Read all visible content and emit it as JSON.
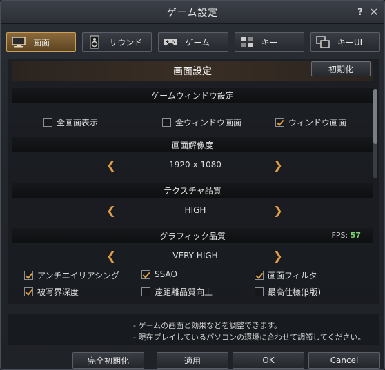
{
  "window": {
    "title": "ゲーム設定",
    "help_icon": "?",
    "close_icon": "✕"
  },
  "tabs": [
    {
      "label": "画面",
      "icon": "monitor-icon",
      "active": true
    },
    {
      "label": "サウンド",
      "icon": "speaker-icon",
      "active": false
    },
    {
      "label": "ゲーム",
      "icon": "gamepad-icon",
      "active": false
    },
    {
      "label": "キー",
      "icon": "keyboard-icon",
      "active": false
    },
    {
      "label": "キーUI",
      "icon": "windows-icon",
      "active": false
    }
  ],
  "screen": {
    "title": "画面設定",
    "reset_label": "初期化",
    "window_section": "ゲームウィンドウ設定",
    "window_options": [
      {
        "label": "全画面表示",
        "checked": false
      },
      {
        "label": "全ウィンドウ画面",
        "checked": false
      },
      {
        "label": "ウィンドウ画面",
        "checked": true
      }
    ],
    "resolution_section": "画面解像度",
    "resolution_value": "1920 x 1080",
    "texture_section": "テクスチャ品質",
    "texture_value": "HIGH",
    "graphics_section": "グラフィック品質",
    "fps_label": "FPS:",
    "fps_value": "57",
    "graphics_value": "VERY HIGH",
    "graphic_options": [
      {
        "label": "アンチエイリアシング",
        "checked": true
      },
      {
        "label": "SSAO",
        "checked": true
      },
      {
        "label": "画面フィルタ",
        "checked": true
      },
      {
        "label": "被写界深度",
        "checked": true
      },
      {
        "label": "遠距離品質向上",
        "checked": false
      },
      {
        "label": "最高仕様(β版)",
        "checked": false
      }
    ]
  },
  "info": {
    "line1": "- ゲームの画面と効果などを調整できます。",
    "line2": "- 現在プレイしているパソコンの環境に合わせて調節してください。"
  },
  "footer": {
    "full_reset": "完全初期化",
    "apply": "適用",
    "ok": "OK",
    "cancel": "Cancel"
  },
  "colors": {
    "accent": "#e0a040",
    "fps": "#7ad26e",
    "active_tab": "#8a6a3a"
  }
}
